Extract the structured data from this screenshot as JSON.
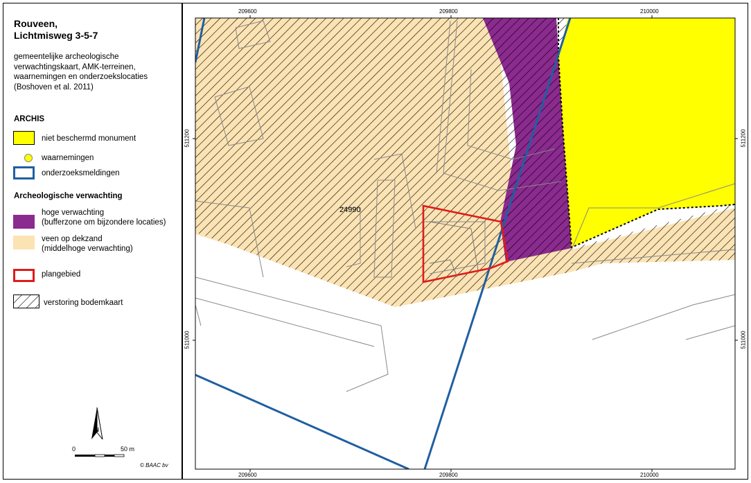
{
  "title": "Rouveen,\nLichtmisweg 3-5-7",
  "subtitle": "gemeentelijke archeologische verwachtingskaart, AMK-terreinen, waarnemingen en onderzoekslocaties (Boshoven et al. 2011)",
  "legend": {
    "archis_heading": "ARCHIS",
    "archis_items": [
      {
        "label": "niet beschermd monument",
        "color": "#ffff00"
      },
      {
        "label": "waarnemingen",
        "color": "#ffff00"
      },
      {
        "label": "onderzoeksmeldingen",
        "color": "#1f5fa0"
      }
    ],
    "verwachting_heading": "Archeologische verwachting",
    "verwachting_items": [
      {
        "label": "hoge verwachting\n(bufferzone om bijzondere locaties)",
        "color": "#8b2a8f"
      },
      {
        "label": "veen op dekzand\n(middelhoge verwachting)",
        "color": "#fce3b4"
      }
    ],
    "plangebied_label": "plangebied",
    "plangebied_color": "#e01a1a",
    "verstoring_label": "verstoring bodemkaart"
  },
  "map": {
    "x_ticks": [
      "209600",
      "209800",
      "210000"
    ],
    "y_ticks": [
      "511200",
      "511000"
    ],
    "parcel_label": "24990"
  },
  "north_label": "N",
  "scale": {
    "start": "0",
    "end": "50 m"
  },
  "copyright": "© BAAC bv"
}
